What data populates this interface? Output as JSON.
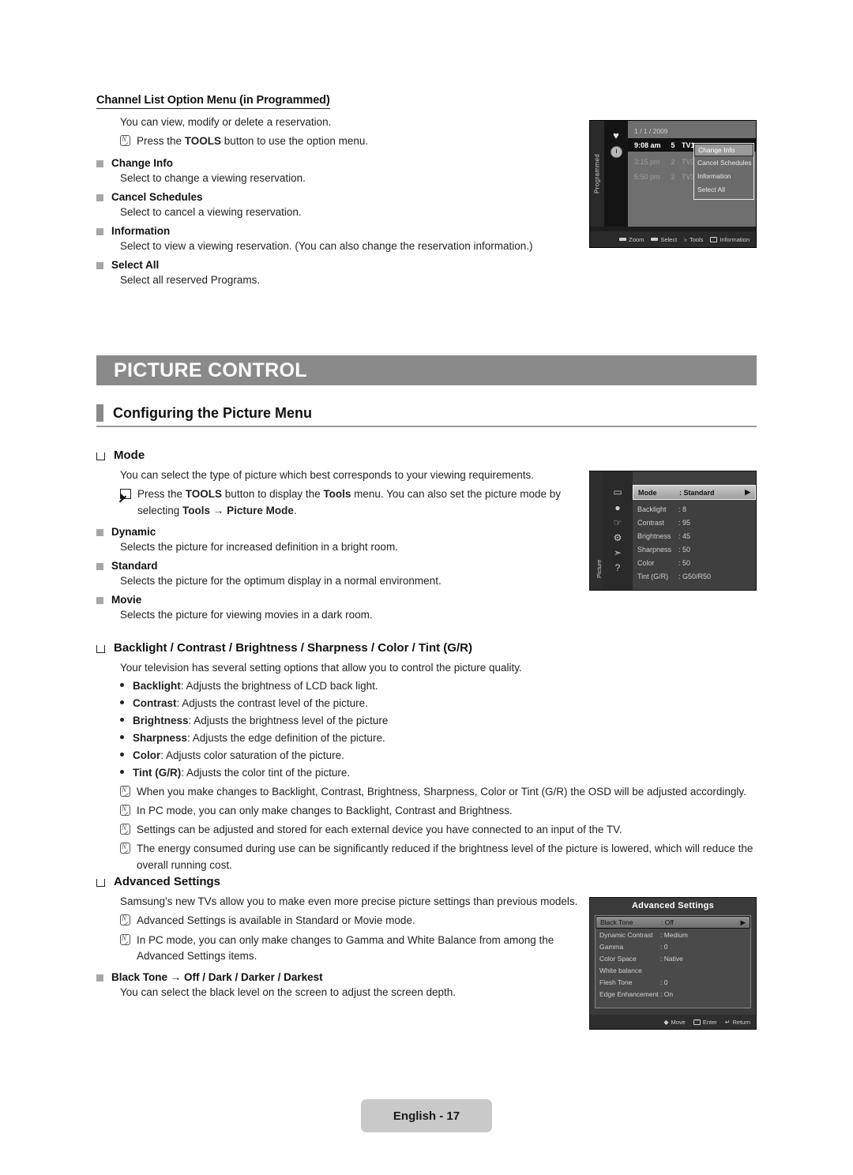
{
  "top_section": {
    "heading": "Channel List Option Menu (in Programmed)",
    "intro": "You can view, modify or delete a reservation.",
    "note": {
      "pre": "Press the ",
      "bold": "TOOLS",
      "post": " button to use the option menu."
    },
    "items": [
      {
        "label": "Change Info",
        "desc": "Select to change a viewing reservation."
      },
      {
        "label": "Cancel Schedules",
        "desc": "Select to cancel a viewing reservation."
      },
      {
        "label": "Information",
        "desc": "Select to view a viewing reservation. (You can also change the reservation information.)"
      },
      {
        "label": "Select All",
        "desc": "Select all reserved Programs."
      }
    ]
  },
  "banner": {
    "title": "PICTURE CONTROL"
  },
  "subhead": {
    "title": "Configuring the Picture Menu"
  },
  "mode_section": {
    "heading": "Mode",
    "intro": "You can select the type of picture which best corresponds to your viewing requirements.",
    "tools_note": {
      "p1": "Press the ",
      "b1": "TOOLS",
      "p2": " button to display the ",
      "b2": "Tools",
      "p3": " menu. You can also set the picture mode by selecting ",
      "b3": "Tools",
      "p4": " → ",
      "b4": "Picture Mode",
      "p5": "."
    },
    "items": [
      {
        "label": "Dynamic",
        "desc": "Selects the picture for increased definition in a bright room."
      },
      {
        "label": "Standard",
        "desc": "Selects the picture for the optimum display in a normal environment."
      },
      {
        "label": "Movie",
        "desc": "Selects the picture for viewing movies in a dark room."
      }
    ]
  },
  "backlight_section": {
    "heading": "Backlight / Contrast / Brightness / Sharpness / Color / Tint (G/R)",
    "intro": "Your television has several setting options that allow you to control the picture quality.",
    "bullets": [
      {
        "term": "Backlight",
        "desc": ": Adjusts the brightness of LCD back light."
      },
      {
        "term": "Contrast",
        "desc": ": Adjusts the contrast level of the picture."
      },
      {
        "term": "Brightness",
        "desc": ": Adjusts the brightness level of the picture"
      },
      {
        "term": "Sharpness",
        "desc": ": Adjusts the edge definition of the picture."
      },
      {
        "term": "Color",
        "desc": ": Adjusts color saturation of the picture."
      },
      {
        "term": "Tint (G/R)",
        "desc": ": Adjusts the color tint of the picture."
      }
    ],
    "notes": [
      "When you make changes to Backlight, Contrast, Brightness, Sharpness, Color or Tint (G/R) the OSD will be adjusted accordingly.",
      "In PC mode, you can only make changes to Backlight, Contrast and Brightness.",
      "Settings can be adjusted and stored for each external device you have connected to an input of the TV.",
      "The energy consumed during use can be significantly reduced if the brightness level of the picture is lowered, which will reduce the overall running cost."
    ]
  },
  "advanced_section": {
    "heading": "Advanced Settings",
    "intro": "Samsung's new TVs allow you to make even more precise picture settings than previous models.",
    "notes": [
      "Advanced Settings is available in Standard or Movie mode.",
      "In PC mode, you can only make changes to Gamma and White Balance from among the Advanced Settings items."
    ],
    "item": {
      "label": "Black Tone → Off / Dark / Darker / Darkest",
      "desc": "You can select the black level on the screen to adjust the screen depth."
    }
  },
  "osd_programmed": {
    "side_label": "Programmed",
    "date": "1 / 1 / 2009",
    "rows": [
      {
        "time": "9:08 am",
        "ch": "5",
        "name": "TV1",
        "selected": true
      },
      {
        "time": "3:15 pm",
        "ch": "2",
        "name": "TV3",
        "selected": false
      },
      {
        "time": "5:50 pm",
        "ch": "2",
        "name": "TV3",
        "selected": false
      }
    ],
    "menu": [
      {
        "label": "Change Info",
        "selected": true
      },
      {
        "label": "Cancel Schedules",
        "selected": false
      },
      {
        "label": "Information",
        "selected": false
      },
      {
        "label": "Select All",
        "selected": false
      }
    ],
    "footer": [
      {
        "icon": "red-bar-icon",
        "label": "Zoom"
      },
      {
        "icon": "green-bar-icon",
        "label": "Select"
      },
      {
        "icon": "tools-icon",
        "label": "Tools"
      },
      {
        "icon": "enter-icon",
        "label": "Information"
      }
    ]
  },
  "osd_picture": {
    "side_label": "Picture",
    "icons": [
      "picture-icon",
      "sound-icon",
      "channel-icon",
      "setup-icon",
      "input-icon",
      "support-icon"
    ],
    "rows": [
      {
        "key": "Mode",
        "value": ": Standard",
        "selected": true
      },
      {
        "key": "Backlight",
        "value": ": 8",
        "selected": false
      },
      {
        "key": "Contrast",
        "value": ": 95",
        "selected": false
      },
      {
        "key": "Brightness",
        "value": ": 45",
        "selected": false
      },
      {
        "key": "Sharpness",
        "value": ": 50",
        "selected": false
      },
      {
        "key": "Color",
        "value": ": 50",
        "selected": false
      },
      {
        "key": "Tint (G/R)",
        "value": ": G50/R50",
        "selected": false
      }
    ]
  },
  "osd_advanced": {
    "title": "Advanced Settings",
    "rows": [
      {
        "key": "Black Tone",
        "value": ": Off",
        "selected": true
      },
      {
        "key": "Dynamic Contrast",
        "value": ": Medium",
        "selected": false
      },
      {
        "key": "Gamma",
        "value": ": 0",
        "selected": false
      },
      {
        "key": "Color Space",
        "value": ": Native",
        "selected": false
      },
      {
        "key": "White balance",
        "value": "",
        "selected": false
      },
      {
        "key": "Flesh Tone",
        "value": ": 0",
        "selected": false
      },
      {
        "key": "Edge Enhancement",
        "value": ": On",
        "selected": false
      }
    ],
    "footer": [
      {
        "icon": "updown-icon",
        "label": "Move"
      },
      {
        "icon": "enter-icon",
        "label": "Enter"
      },
      {
        "icon": "return-icon",
        "label": "Return"
      }
    ]
  },
  "page_footer": {
    "label": "English - 17"
  },
  "colors": {
    "banner_gray": "#8a8a8a",
    "bullet_gray": "#a6a6a6",
    "footer_gray": "#c9c9c9",
    "text": "#1a1a1a"
  }
}
